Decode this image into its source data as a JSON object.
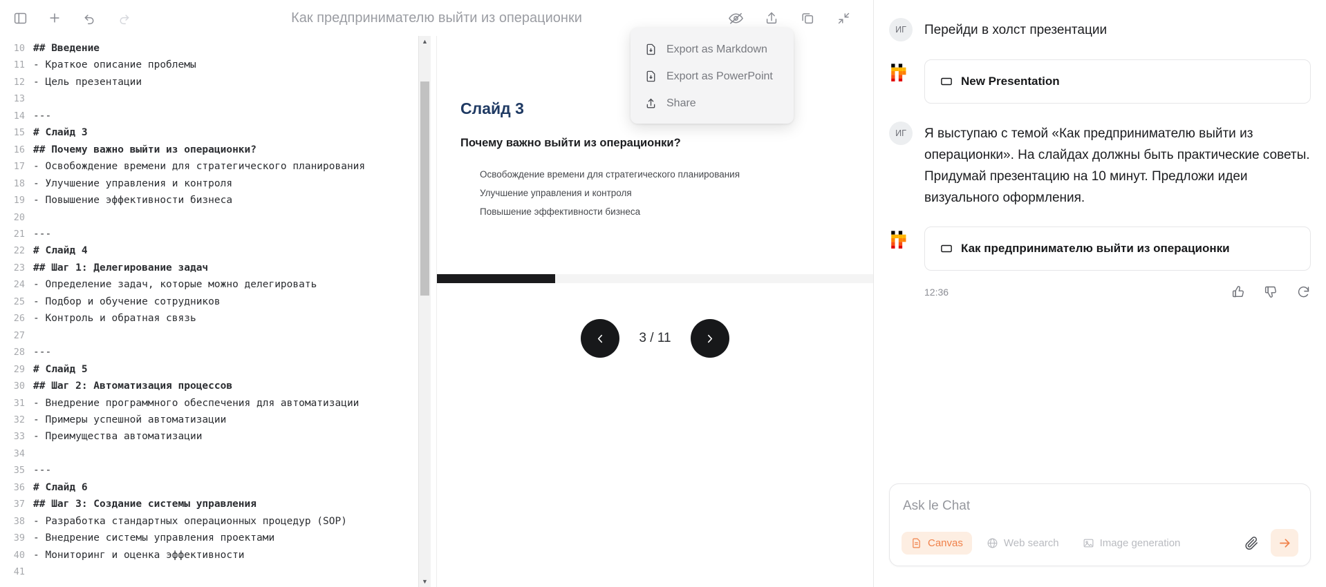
{
  "canvas": {
    "title": "Как предпринимателю выйти из операционки",
    "toolbar_left": [
      {
        "name": "sidebar-toggle",
        "icon": "panel-left-icon"
      },
      {
        "name": "new-chat",
        "icon": "plus-icon"
      },
      {
        "name": "undo",
        "icon": "undo-icon"
      },
      {
        "name": "redo",
        "icon": "redo-icon"
      }
    ],
    "toolbar_right": [
      {
        "name": "hide-preview",
        "icon": "eye-off-icon"
      },
      {
        "name": "export",
        "icon": "share-upload-icon"
      },
      {
        "name": "copy",
        "icon": "copy-icon"
      },
      {
        "name": "collapse",
        "icon": "collapse-arrows-icon"
      }
    ]
  },
  "export_menu": {
    "items": [
      {
        "label": "Export as Markdown",
        "icon": "file-download-icon"
      },
      {
        "label": "Export as PowerPoint",
        "icon": "file-download-icon"
      },
      {
        "label": "Share",
        "icon": "share-upload-icon"
      }
    ]
  },
  "editor": {
    "lines": [
      {
        "n": "10",
        "text": "## Введение",
        "bold": true
      },
      {
        "n": "11",
        "text": "- Краткое описание проблемы",
        "bold": false
      },
      {
        "n": "12",
        "text": "- Цель презентации",
        "bold": false
      },
      {
        "n": "13",
        "text": "",
        "bold": false
      },
      {
        "n": "14",
        "text": "---",
        "bold": false
      },
      {
        "n": "15",
        "text": "# Слайд 3",
        "bold": true
      },
      {
        "n": "16",
        "text": "## Почему важно выйти из операционки?",
        "bold": true
      },
      {
        "n": "17",
        "text": "- Освобождение времени для стратегического планирования",
        "bold": false
      },
      {
        "n": "18",
        "text": "- Улучшение управления и контроля",
        "bold": false
      },
      {
        "n": "19",
        "text": "- Повышение эффективности бизнеса",
        "bold": false
      },
      {
        "n": "20",
        "text": "",
        "bold": false
      },
      {
        "n": "21",
        "text": "---",
        "bold": false
      },
      {
        "n": "22",
        "text": "# Слайд 4",
        "bold": true
      },
      {
        "n": "23",
        "text": "## Шаг 1: Делегирование задач",
        "bold": true
      },
      {
        "n": "24",
        "text": "- Определение задач, которые можно делегировать",
        "bold": false
      },
      {
        "n": "25",
        "text": "- Подбор и обучение сотрудников",
        "bold": false
      },
      {
        "n": "26",
        "text": "- Контроль и обратная связь",
        "bold": false
      },
      {
        "n": "27",
        "text": "",
        "bold": false
      },
      {
        "n": "28",
        "text": "---",
        "bold": false
      },
      {
        "n": "29",
        "text": "# Слайд 5",
        "bold": true
      },
      {
        "n": "30",
        "text": "## Шаг 2: Автоматизация процессов",
        "bold": true
      },
      {
        "n": "31",
        "text": "- Внедрение программного обеспечения для автоматизации",
        "bold": false
      },
      {
        "n": "32",
        "text": "- Примеры успешной автоматизации",
        "bold": false
      },
      {
        "n": "33",
        "text": "- Преимущества автоматизации",
        "bold": false
      },
      {
        "n": "34",
        "text": "",
        "bold": false
      },
      {
        "n": "35",
        "text": "---",
        "bold": false
      },
      {
        "n": "36",
        "text": "# Слайд 6",
        "bold": true
      },
      {
        "n": "37",
        "text": "## Шаг 3: Создание системы управления",
        "bold": true
      },
      {
        "n": "38",
        "text": "- Разработка стандартных операционных процедур (SOP)",
        "bold": false
      },
      {
        "n": "39",
        "text": "- Внедрение системы управления проектами",
        "bold": false
      },
      {
        "n": "40",
        "text": "- Мониторинг и оценка эффективности",
        "bold": false
      },
      {
        "n": "41",
        "text": "",
        "bold": false
      }
    ]
  },
  "slide": {
    "title": "Слайд 3",
    "subtitle": "Почему важно выйти из операционки?",
    "bullets": [
      "Освобождение времени для стратегического планирования",
      "Улучшение управления и контроля",
      "Повышение эффективности бизнеса"
    ],
    "counter": "3 / 11",
    "prev_icon": "chevron-left-icon",
    "next_icon": "chevron-right-icon",
    "title_color": "#1f3a63"
  },
  "chat": {
    "messages": [
      {
        "author": "ИГ",
        "type": "user",
        "text": "Перейди в холст презентации"
      },
      {
        "author": "mistral",
        "type": "assistant-card",
        "card_label": "New Presentation",
        "card_icon": "canvas-icon"
      },
      {
        "author": "ИГ",
        "type": "user",
        "text": "Я выступаю с темой «Как предпринимателю выйти из операционки». На слайдах должны быть практические советы. Придумай презентацию на 10 минут. Предложи идеи визуального оформления."
      },
      {
        "author": "mistral",
        "type": "assistant-card",
        "card_label": "Как предпринимателю выйти из операционки",
        "card_icon": "canvas-icon"
      }
    ],
    "timestamp": "12:36",
    "actions": [
      {
        "name": "thumbs-up",
        "icon": "thumbs-up-icon"
      },
      {
        "name": "thumbs-down",
        "icon": "thumbs-down-icon"
      },
      {
        "name": "regenerate",
        "icon": "refresh-icon"
      }
    ]
  },
  "composer": {
    "placeholder": "Ask le Chat",
    "value": "",
    "chips": [
      {
        "label": "Canvas",
        "icon": "document-icon",
        "active": true
      },
      {
        "label": "Web search",
        "icon": "globe-icon",
        "active": false
      },
      {
        "label": "Image generation",
        "icon": "image-icon",
        "active": false
      }
    ],
    "attach_icon": "paperclip-icon",
    "send_icon": "arrow-right-icon",
    "accent": "#f0814a",
    "accent_bg": "#fdeee2"
  }
}
